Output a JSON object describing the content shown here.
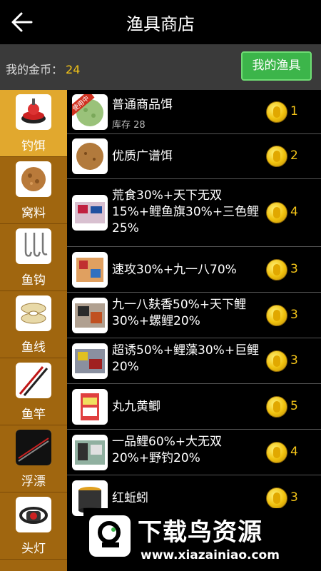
{
  "header": {
    "title": "渔具商店",
    "back_icon": "back-arrow-icon"
  },
  "coins": {
    "label": "我的金币：",
    "value": "24"
  },
  "my_gear_button": "我的渔具",
  "sidebar": {
    "items": [
      {
        "label": "钓饵",
        "icon": "bait-icon",
        "active": true
      },
      {
        "label": "窝料",
        "icon": "groundbait-icon",
        "active": false
      },
      {
        "label": "鱼钩",
        "icon": "hook-icon",
        "active": false
      },
      {
        "label": "鱼线",
        "icon": "line-spool-icon",
        "active": false
      },
      {
        "label": "鱼竿",
        "icon": "rod-icon",
        "active": false
      },
      {
        "label": "浮漂",
        "icon": "float-icon",
        "active": false
      },
      {
        "label": "头灯",
        "icon": "headlamp-icon",
        "active": false
      }
    ]
  },
  "products": [
    {
      "name": "普通商品饵",
      "stock": "库存 28",
      "price": "1",
      "badge": "使用中"
    },
    {
      "name": "优质广谱饵",
      "price": "2"
    },
    {
      "name": "荒食30%+天下无双15%+鲤鱼旗30%+三色鲤25%",
      "price": "4"
    },
    {
      "name": "速攻30%+九一八70%",
      "price": "3"
    },
    {
      "name": "九一八麸香50%+天下鲤30%+螺鲤20%",
      "price": "3"
    },
    {
      "name": "超诱50%+鲤藻30%+巨鲤20%",
      "price": "3"
    },
    {
      "name": "丸九黄鲫",
      "price": "5"
    },
    {
      "name": "一品鲤60%+大无双20%+野钓20%",
      "price": "4"
    },
    {
      "name": "红蚯蚓",
      "price": "3"
    }
  ],
  "watermark": {
    "text": "下载鸟资源",
    "url": "www.xiazainiao.com"
  },
  "colors": {
    "accent_gold": "#f5c518",
    "sidebar_bg": "#a0660f",
    "sidebar_active": "#e1a82e",
    "button_green": "#3cb54a"
  }
}
